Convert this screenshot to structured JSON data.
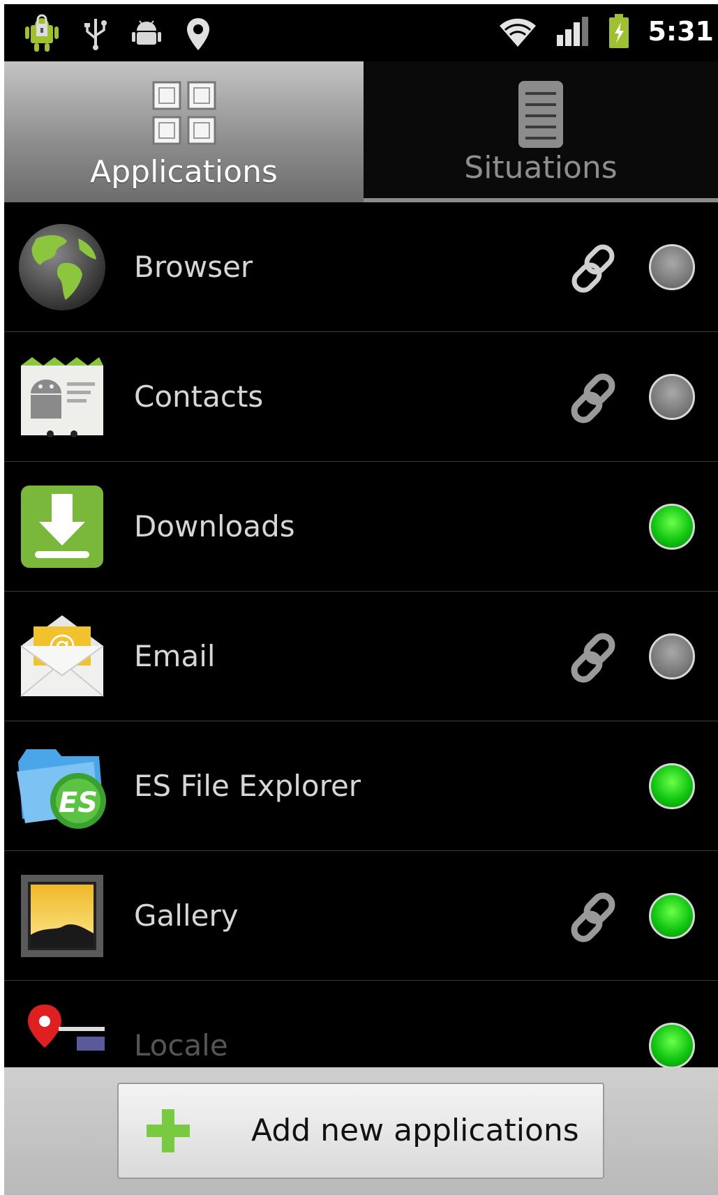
{
  "status_bar": {
    "time": "5:31",
    "icons": [
      "android-lock-icon",
      "usb-icon",
      "android-debug-icon",
      "location-pin-icon",
      "wifi-icon",
      "signal-icon",
      "battery-charging-icon"
    ]
  },
  "tabs": [
    {
      "label": "Applications",
      "icon": "grid-icon",
      "selected": true
    },
    {
      "label": "Situations",
      "icon": "list-icon",
      "selected": false
    }
  ],
  "apps": [
    {
      "name": "Browser",
      "icon": "globe-icon",
      "linked": true,
      "enabled": false
    },
    {
      "name": "Contacts",
      "icon": "contacts-icon",
      "linked": true,
      "enabled": false
    },
    {
      "name": "Downloads",
      "icon": "download-icon",
      "linked": false,
      "enabled": true
    },
    {
      "name": "Email",
      "icon": "email-icon",
      "linked": true,
      "enabled": false
    },
    {
      "name": "ES File Explorer",
      "icon": "es-file-explorer-icon",
      "linked": false,
      "enabled": true
    },
    {
      "name": "Gallery",
      "icon": "gallery-icon",
      "linked": true,
      "enabled": true
    },
    {
      "name": "Locale",
      "icon": "locale-icon",
      "linked": false,
      "enabled": true
    }
  ],
  "bottom": {
    "add_button_label": "Add new applications"
  },
  "colors": {
    "enabled": "#12c612",
    "disabled": "#7a7a7a",
    "plus_green": "#7ac943"
  }
}
